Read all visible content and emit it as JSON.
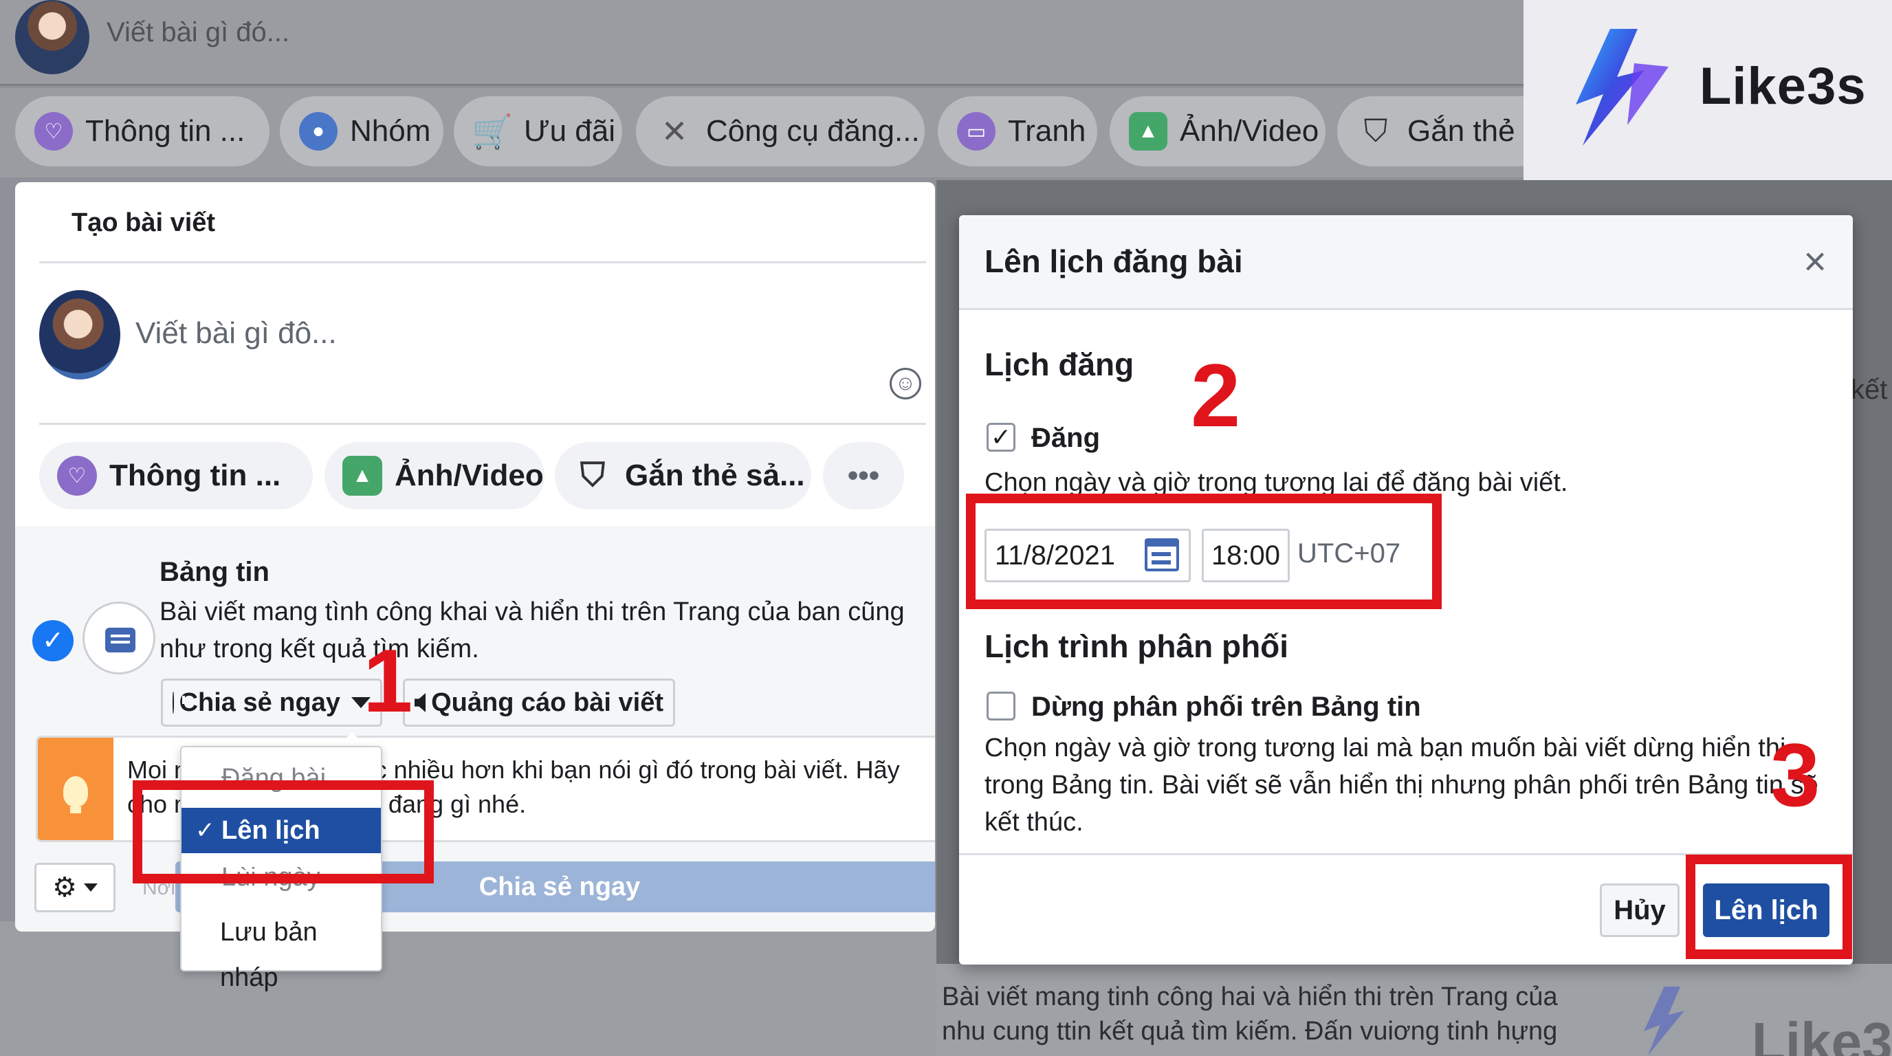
{
  "background": {
    "compose_placeholder": "Viết bài gì đó...",
    "pills": [
      {
        "label": "Thông tin ...",
        "icon": "heart-icon"
      },
      {
        "label": "Nhóm",
        "icon": "group-icon"
      },
      {
        "label": "Ưu đãi",
        "icon": "cart-icon"
      },
      {
        "label": "Công cụ đăng...",
        "icon": "tools-icon"
      },
      {
        "label": "Tranh",
        "icon": "canvas-icon"
      },
      {
        "label": "Ảnh/Video",
        "icon": "photo-icon"
      },
      {
        "label": "Gắn thẻ s",
        "icon": "shopping-bag-icon"
      }
    ],
    "side_text": "kết",
    "bottom_text": "Bài viết mang tinh công hai và hiển thi trèn Trang của nhu cung ttin kết quả tìm kiếm. Đấn vuiơng tinh hựng vong"
  },
  "create_post": {
    "title": "Tạo bài viết",
    "placeholder": "Viết bài gì đô...",
    "pills": [
      {
        "label": "Thông tin ...",
        "icon": "heart-icon"
      },
      {
        "label": "Ảnh/Video",
        "icon": "photo-icon"
      },
      {
        "label": "Gắn thẻ sả...",
        "icon": "shopping-bag-icon"
      },
      {
        "label": "•••",
        "icon": "more-icon"
      }
    ],
    "feed": {
      "title": "Bảng tin",
      "description": "Bài viết mang tình công khai và hiển thi trên Trang của ban cũng như trong kết quả tìm kiếm."
    },
    "share_now_dropdown": "Chia sẻ ngay",
    "promote_button": "Quảng cáo bài viết",
    "tip_text": "Mọi người sẽ tương tác nhiều hơn khi bạn nói gì đó trong bài viết. Hãy cho mọi người biết bạn đang gì nhé.",
    "share_button": "Chia sẻ ngay",
    "publish_hint": "Nơi"
  },
  "dropdown": {
    "items": [
      {
        "label": "Đăng bài",
        "state": "faded"
      },
      {
        "label": "Lên lịch",
        "state": "active"
      },
      {
        "label": "Lùi ngày",
        "state": "faded"
      },
      {
        "label": "Lưu bản nháp",
        "state": "normal"
      }
    ]
  },
  "schedule_dialog": {
    "title": "Lên lịch đăng bài",
    "close": "×",
    "section_schedule": "Lịch đăng",
    "publish_checkbox": {
      "label": "Đăng",
      "checked": true
    },
    "publish_hint": "Chọn ngày và giờ trong tương lai để đăng bài viết.",
    "date": "11/8/2021",
    "time": "18:00",
    "timezone": "UTC+07",
    "section_distribution": "Lịch trình phân phối",
    "stop_checkbox": {
      "label": "Dừng phân phối trên Bảng tin",
      "checked": false
    },
    "stop_hint": "Chọn ngày và giờ trong tương lai mà bạn muốn bài viết dừng hiển thị trong Bảng tin. Bài viết sẽ vẫn hiển thị nhưng phân phối trên Bảng tin sẽ kết thúc.",
    "cancel_button": "Hủy",
    "schedule_button": "Lên lịch"
  },
  "annotations": {
    "step1": "1",
    "step2": "2",
    "step3": "3"
  },
  "brand": {
    "name": "Like3s"
  },
  "colors": {
    "accent_blue": "#1877f2",
    "button_blue": "#1e4fa2",
    "annotation_red": "#e0141b",
    "tip_orange": "#f7923a"
  }
}
